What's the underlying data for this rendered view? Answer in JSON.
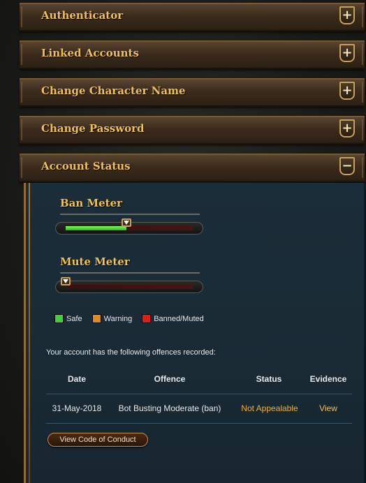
{
  "sections": [
    {
      "title": "Authenticator",
      "toggle": "+"
    },
    {
      "title": "Linked Accounts",
      "toggle": "+"
    },
    {
      "title": "Change Character Name",
      "toggle": "+"
    },
    {
      "title": "Change Password",
      "toggle": "+"
    },
    {
      "title": "Account Status",
      "toggle": "−"
    }
  ],
  "account_status": {
    "ban_meter": {
      "label": "Ban Meter",
      "level": 0.48
    },
    "mute_meter": {
      "label": "Mute Meter",
      "level": 0.0
    },
    "legend": [
      {
        "label": "Safe",
        "color": "#3fd13a"
      },
      {
        "label": "Warning",
        "color": "#e08a1a"
      },
      {
        "label": "Banned/Muted",
        "color": "#d81e1e"
      }
    ],
    "offences_intro": "Your account has the following offences recorded:",
    "table": {
      "headers": [
        "Date",
        "Offence",
        "Status",
        "Evidence"
      ],
      "rows": [
        {
          "date": "31-May-2018",
          "offence": "Bot Busting Moderate (ban)",
          "status": "Not Appealable",
          "evidence": "View"
        }
      ]
    },
    "code_button": "View Code of Conduct"
  },
  "colors": {
    "accent_gold": "#f0c050",
    "status_orange": "#f0b030",
    "link_gold": "#f0c050"
  }
}
